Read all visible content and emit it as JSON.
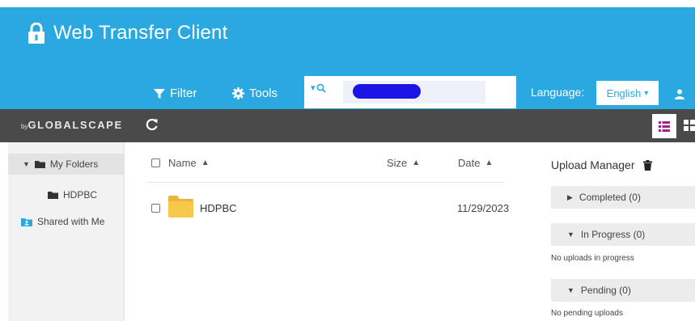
{
  "header": {
    "title": "Web Transfer Client",
    "filter_label": "Filter",
    "tools_label": "Tools",
    "search": {
      "placeholder": "",
      "value": ""
    },
    "language_label": "Language:",
    "language_selected": "English"
  },
  "toolbar": {
    "logo_prefix": "by",
    "logo_text": "GLOBALSCAPE"
  },
  "sidebar": {
    "items": [
      {
        "label": "My Folders"
      },
      {
        "label": "HDPBC"
      },
      {
        "label": "Shared with Me"
      }
    ]
  },
  "file_list": {
    "columns": {
      "name": "Name",
      "size": "Size",
      "date": "Date"
    },
    "rows": [
      {
        "name": "HDPBC",
        "date": "11/29/2023"
      }
    ]
  },
  "upload_manager": {
    "title": "Upload Manager",
    "sections": [
      {
        "label": "Completed (0)",
        "note": ""
      },
      {
        "label": "In Progress (0)",
        "note": "No uploads in progress"
      },
      {
        "label": "Pending (0)",
        "note": "No pending uploads"
      }
    ]
  },
  "colors": {
    "header_bg": "#29a9e0",
    "toolbar_bg": "#4a4a4a",
    "accent_purple": "#a0208c",
    "folder_yellow": "#f7c94a"
  },
  "icons": [
    "lock-icon",
    "filter-icon",
    "gear-icon",
    "search-icon",
    "user-icon",
    "refresh-icon",
    "list-view-icon",
    "grid-view-icon",
    "folder-icon",
    "shared-folder-icon",
    "trash-icon",
    "caret-icon"
  ]
}
